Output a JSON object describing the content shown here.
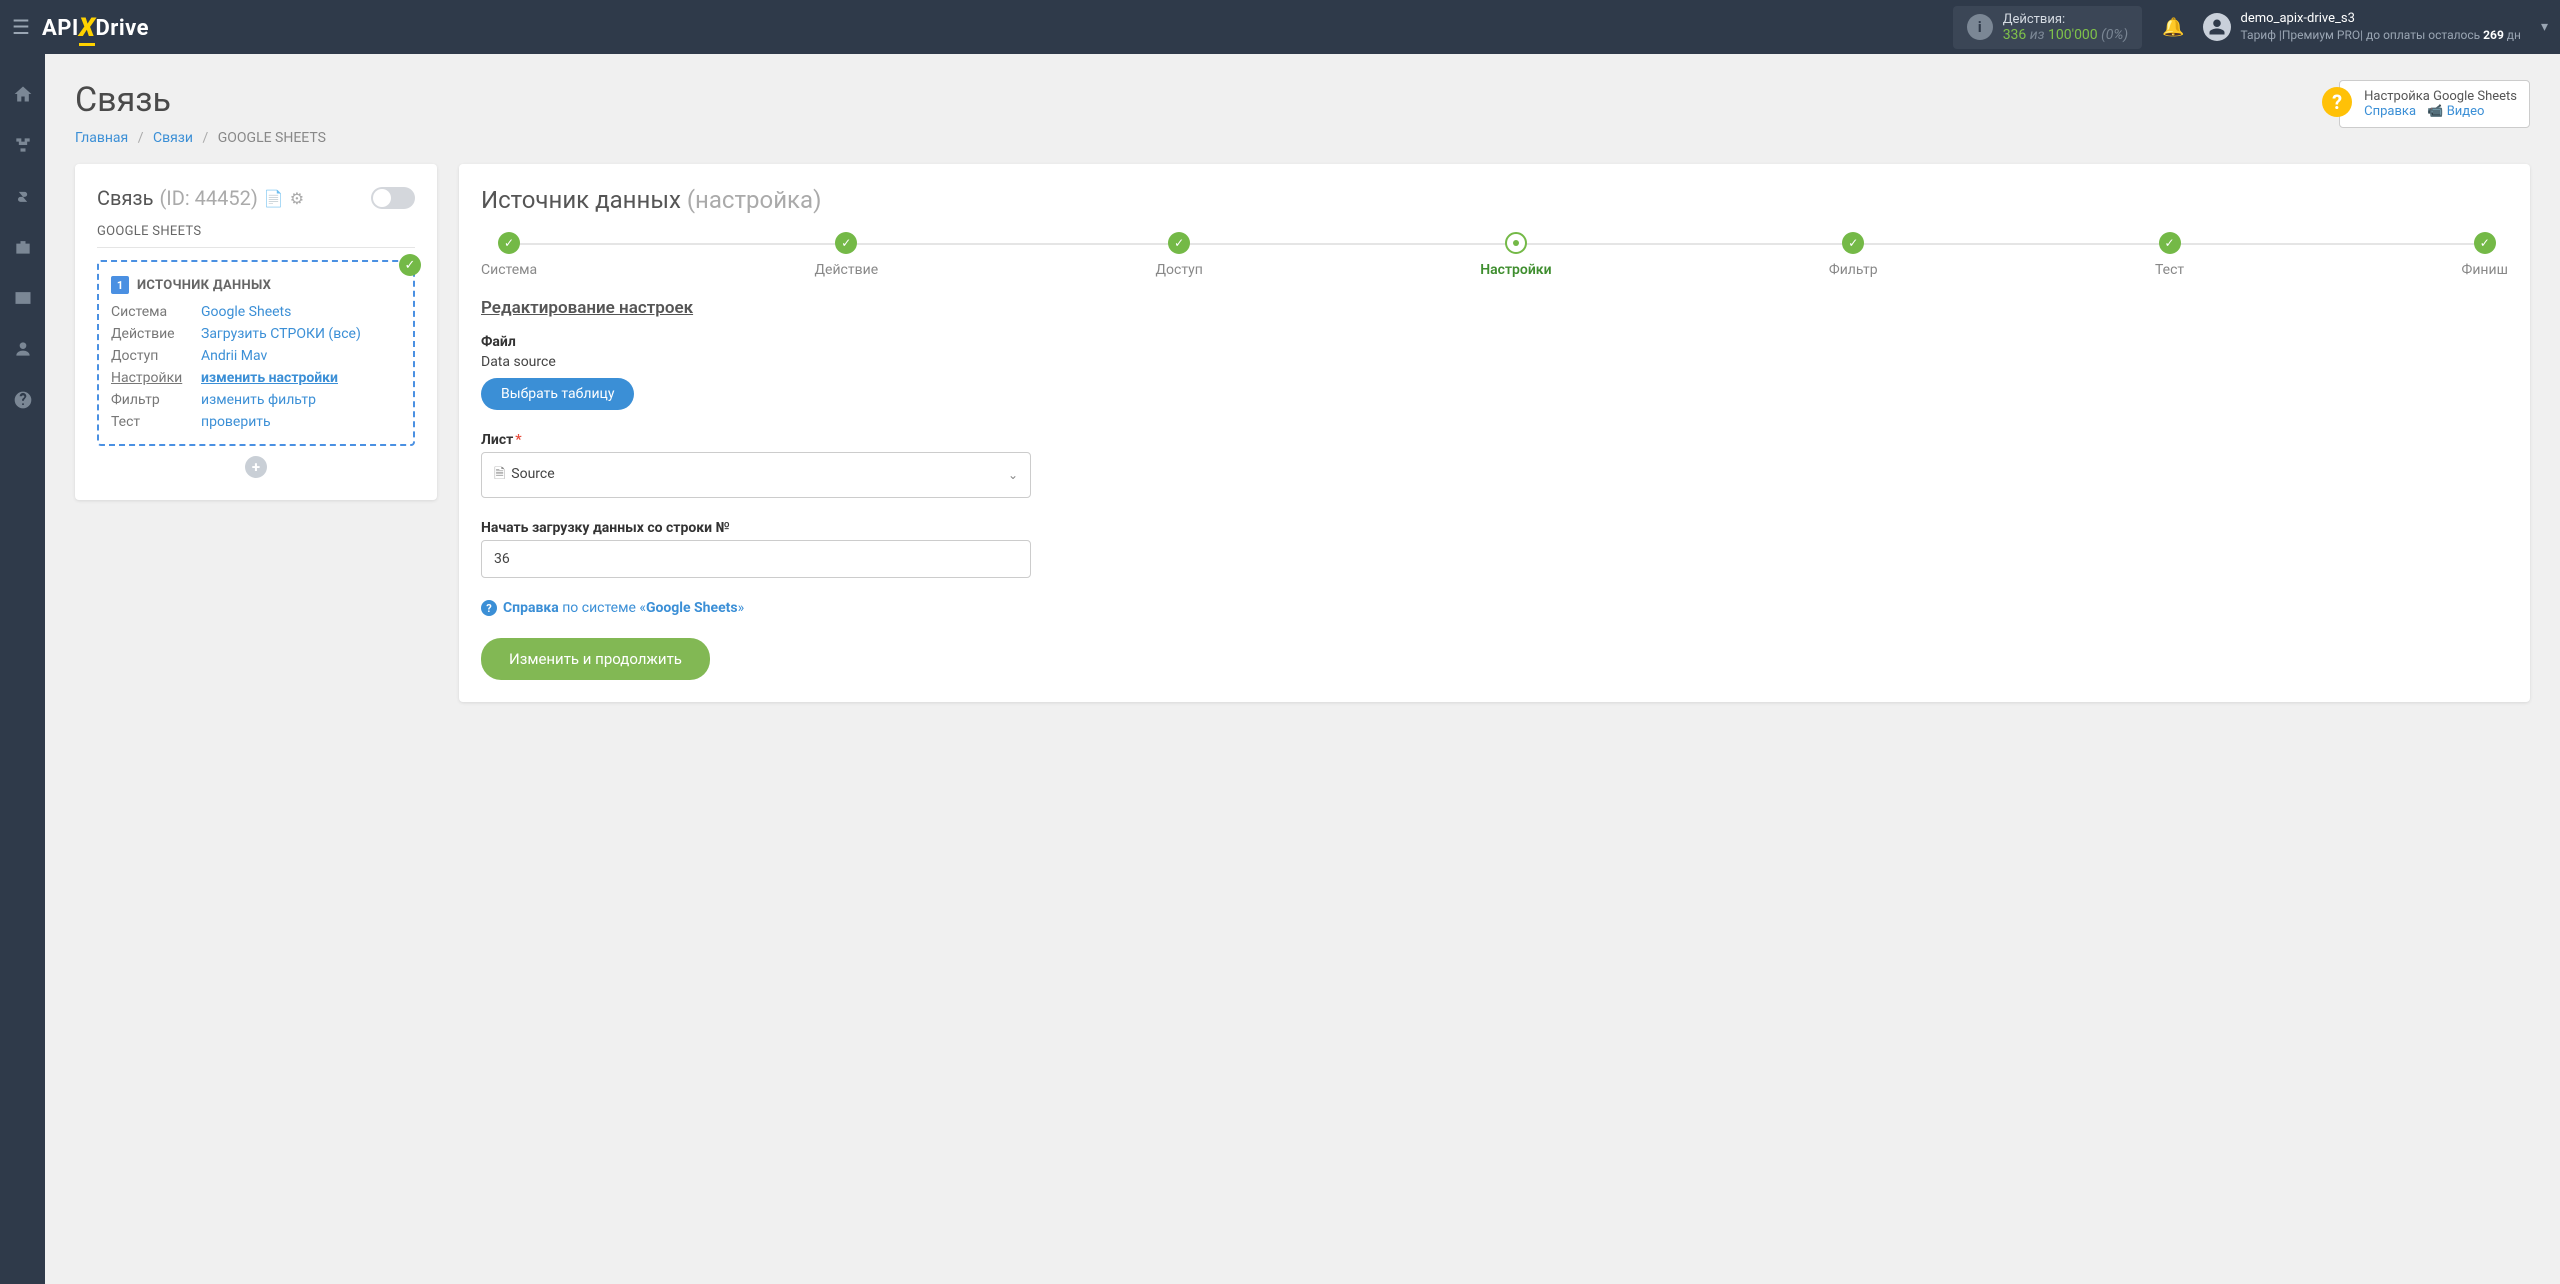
{
  "topbar": {
    "actions_label": "Действия:",
    "actions_count": "336",
    "actions_of": "из",
    "actions_total": "100'000",
    "actions_pct": "(0%)",
    "username": "demo_apix-drive_s3",
    "tariff_prefix": "Тариф |Премиум PRO| до оплаты осталось ",
    "days": "269",
    "days_suffix": " дн"
  },
  "page": {
    "title": "Связь",
    "bc_home": "Главная",
    "bc_links": "Связи",
    "bc_current": "GOOGLE SHEETS"
  },
  "helpbox": {
    "title": "Настройка Google Sheets",
    "ref": "Справка",
    "video": "Видео"
  },
  "left": {
    "conn": "Связь",
    "id": "(ID: 44452)",
    "system_name": "GOOGLE SHEETS",
    "source_header": "ИСТОЧНИК ДАННЫХ",
    "rows": {
      "system_k": "Система",
      "system_v": "Google Sheets",
      "action_k": "Действие",
      "action_v": "Загрузить СТРОКИ (все)",
      "access_k": "Доступ",
      "access_v": "Andrii Mav",
      "settings_k": "Настройки",
      "settings_v": "изменить настройки",
      "filter_k": "Фильтр",
      "filter_v": "изменить фильтр",
      "test_k": "Тест",
      "test_v": "проверить"
    }
  },
  "right": {
    "title": "Источник данных",
    "subtitle": "(настройка)",
    "steps": [
      "Система",
      "Действие",
      "Доступ",
      "Настройки",
      "Фильтр",
      "Тест",
      "Финиш"
    ],
    "section": "Редактирование настроек",
    "file_lbl": "Файл",
    "file_val": "Data source",
    "choose_btn": "Выбрать таблицу",
    "sheet_lbl": "Лист",
    "sheet_val": "Source",
    "row_lbl": "Начать загрузку данных со строки №",
    "row_val": "36",
    "help_pre": "Справка",
    "help_mid": " по системе «",
    "help_sys": "Google Sheets",
    "help_post": "»",
    "submit": "Изменить и продолжить"
  }
}
